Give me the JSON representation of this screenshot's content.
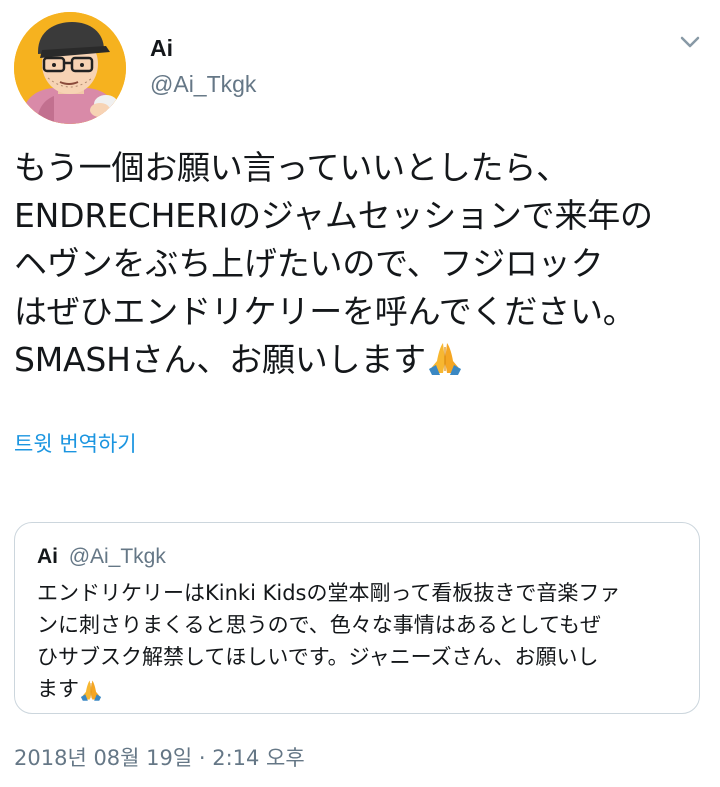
{
  "author": {
    "display_name": "Ai",
    "handle": "@Ai_Tkgk",
    "avatar_icon": "cartoon-avatar-icon"
  },
  "menu_icon": "chevron-down-icon",
  "tweet": {
    "lines": [
      "もう一個お願い言っていいとしたら、",
      "ENDRECHERIのジャムセッションで来年の",
      "ヘヴンをぶち上げたいので、フジロック",
      "はぜひエンドリケリーを呼んでください。",
      "SMASHさん、お願いします"
    ],
    "emoji": "folded-hands-icon",
    "translate_label": "트윗 번역하기"
  },
  "quote": {
    "display_name": "Ai",
    "handle": "@Ai_Tkgk",
    "lines": [
      "エンドリケリーはKinki Kidsの堂本剛って看板抜きで音楽ファ",
      "ンに刺さりまくると思うので、色々な事情はあるとしてもぜ",
      "ひサブスク解禁してほしいです。ジャニーズさん、お願いし",
      "ます"
    ],
    "emoji": "folded-hands-icon"
  },
  "timestamp": "2018년 08월 19일 · 2:14 오후",
  "colors": {
    "text": "#14171a",
    "secondary": "#657786",
    "link": "#1b95e0",
    "border": "#ccd6dd",
    "avatar_bg": "#f6b21f"
  }
}
